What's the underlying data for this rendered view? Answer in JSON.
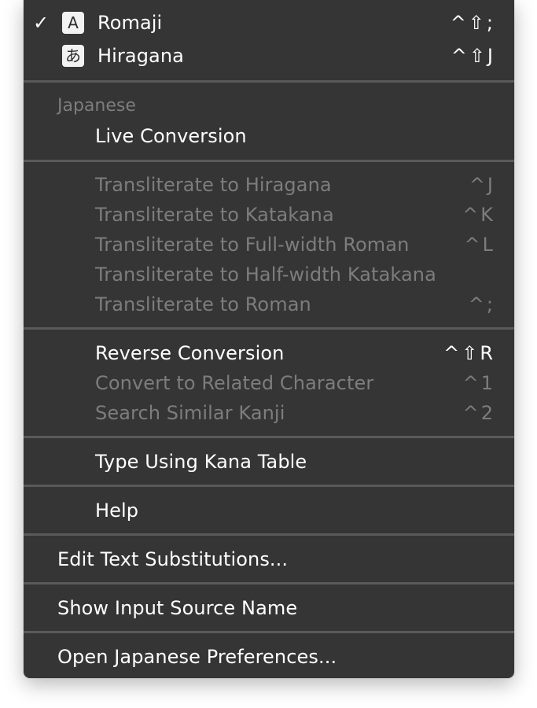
{
  "menu": {
    "sources": [
      {
        "check": "✓",
        "icon_char": "A",
        "icon": "romaji-letter-icon",
        "label": "Romaji",
        "shortcut": "^⇧;"
      },
      {
        "check": "",
        "icon_char": "あ",
        "icon": "hiragana-letter-icon",
        "label": "Hiragana",
        "shortcut": "^⇧J"
      }
    ],
    "section_header": "Japanese",
    "live_conversion": "Live Conversion",
    "transliterate": [
      {
        "label": "Transliterate to Hiragana",
        "shortcut": "^J"
      },
      {
        "label": "Transliterate to Katakana",
        "shortcut": "^K"
      },
      {
        "label": "Transliterate to Full-width Roman",
        "shortcut": "^L"
      },
      {
        "label": "Transliterate to Half-width Katakana",
        "shortcut": ""
      },
      {
        "label": "Transliterate to Roman",
        "shortcut": "^;"
      }
    ],
    "conversion": [
      {
        "label": "Reverse Conversion",
        "shortcut": "^⇧R"
      },
      {
        "label": "Convert to Related Character",
        "shortcut": "^1"
      },
      {
        "label": "Search Similar Kanji",
        "shortcut": "^2"
      }
    ],
    "kana_table": "Type Using Kana Table",
    "help": "Help",
    "edit_substitutions": "Edit Text Substitutions...",
    "show_source_name": "Show Input Source Name",
    "open_preferences": "Open Japanese Preferences..."
  },
  "colors": {
    "menu_background": "#353535",
    "separator": "#5a5a5a",
    "disabled_text": "#7d7d7d",
    "enabled_text": "#ffffff"
  }
}
